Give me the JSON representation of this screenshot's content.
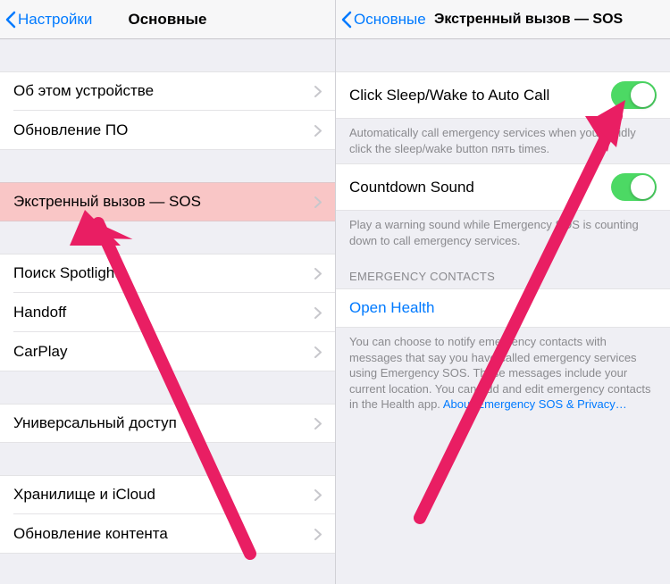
{
  "left": {
    "nav": {
      "back": "Настройки",
      "title": "Основные"
    },
    "group1": [
      {
        "label": "Об этом устройстве"
      },
      {
        "label": "Обновление ПО"
      }
    ],
    "sos": {
      "label": "Экстренный вызов — SOS"
    },
    "group3": [
      {
        "label": "Поиск Spotlight"
      },
      {
        "label": "Handoff"
      },
      {
        "label": "CarPlay"
      }
    ],
    "group4": [
      {
        "label": "Универсальный доступ"
      }
    ],
    "group5": [
      {
        "label": "Хранилище и iCloud"
      },
      {
        "label": "Обновление контента"
      }
    ]
  },
  "right": {
    "nav": {
      "back": "Основные",
      "title": "Экстренный вызов — SOS"
    },
    "auto_call": {
      "label": "Click Sleep/Wake to Auto Call"
    },
    "auto_call_footer": "Automatically call emergency services when you rapidly click the sleep/wake button пять times.",
    "countdown": {
      "label": "Countdown Sound"
    },
    "countdown_footer": "Play a warning sound while Emergency SOS is counting down to call emergency services.",
    "contacts_header": "EMERGENCY CONTACTS",
    "open_health": {
      "label": "Open Health"
    },
    "contacts_footer_a": "You can choose to notify emergency contacts with messages that say you have called emergency services using Emergency SOS. These messages include your current location. You can add and edit emergency contacts in the Health app. ",
    "contacts_footer_link": "About Emergency SOS & Privacy…"
  }
}
